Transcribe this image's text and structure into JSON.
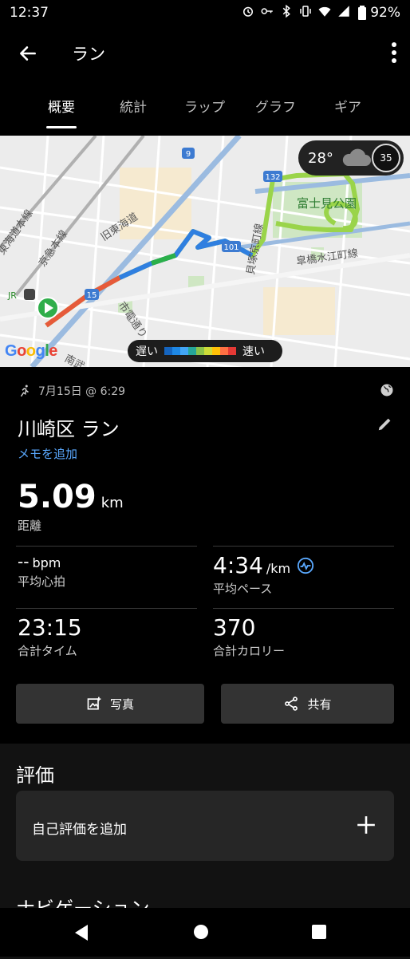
{
  "status": {
    "time": "12:37",
    "battery": "92%"
  },
  "appbar": {
    "title": "ラン"
  },
  "tabs": [
    {
      "label": "概要"
    },
    {
      "label": "統計"
    },
    {
      "label": "ラップ"
    },
    {
      "label": "グラフ"
    },
    {
      "label": "ギア"
    }
  ],
  "map": {
    "weather_temp": "28°",
    "aqi": "35",
    "google": "Google",
    "legend_slow": "遅い",
    "legend_fast": "速い",
    "legend_colors": [
      "#1565c0",
      "#1e88e5",
      "#42a5f5",
      "#26a69a",
      "#8bc34a",
      "#cddc39",
      "#ffc107",
      "#ff7043",
      "#e53935"
    ],
    "labels": [
      {
        "text": "富士見公園"
      },
      {
        "text": "旧東海道"
      },
      {
        "text": "京急本線"
      },
      {
        "text": "東海道本線"
      },
      {
        "text": "市電通り"
      },
      {
        "text": "貝塚京町線"
      },
      {
        "text": "皐橋水江町線"
      },
      {
        "text": "南武"
      }
    ],
    "shields": [
      "9",
      "132",
      "101",
      "15"
    ]
  },
  "activity": {
    "date": "7月15日 @ 6:29",
    "title": "川崎区 ラン",
    "add_memo": "メモを追加",
    "distance_value": "5.09",
    "distance_unit": "km",
    "distance_label": "距離"
  },
  "stats": [
    {
      "value": "--",
      "unit": "bpm",
      "label": "平均心拍"
    },
    {
      "value": "4:34",
      "unit": "/km",
      "label": "平均ペース"
    },
    {
      "value": "23:15",
      "unit": "",
      "label": "合計タイム"
    },
    {
      "value": "370",
      "unit": "",
      "label": "合計カロリー"
    }
  ],
  "buttons": {
    "photo": "写真",
    "share": "共有"
  },
  "rating": {
    "heading": "評価",
    "add": "自己評価を追加"
  },
  "navigation": {
    "heading": "ナビゲーション"
  }
}
